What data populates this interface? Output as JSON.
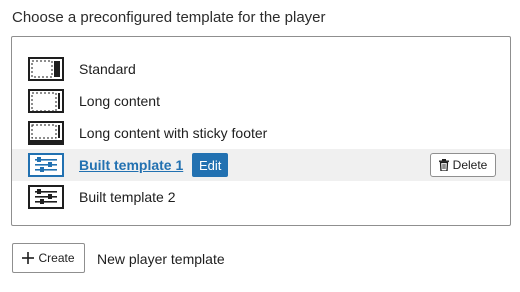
{
  "heading": "Choose a preconfigured template for the player",
  "templates": [
    {
      "label": "Standard",
      "icon": "standard-layout-icon"
    },
    {
      "label": "Long content",
      "icon": "long-content-layout-icon"
    },
    {
      "label": "Long content with sticky footer",
      "icon": "sticky-footer-layout-icon"
    },
    {
      "label": "Built template 1",
      "icon": "sliders-icon",
      "selected": true,
      "edit_label": "Edit",
      "delete_label": "Delete"
    },
    {
      "label": "Built template 2",
      "icon": "sliders-icon"
    }
  ],
  "create": {
    "button_label": "Create",
    "description": "New player template"
  },
  "colors": {
    "accent": "#2271b1",
    "selected_row": "#f0f0f0",
    "border": "#8f8f8f"
  }
}
